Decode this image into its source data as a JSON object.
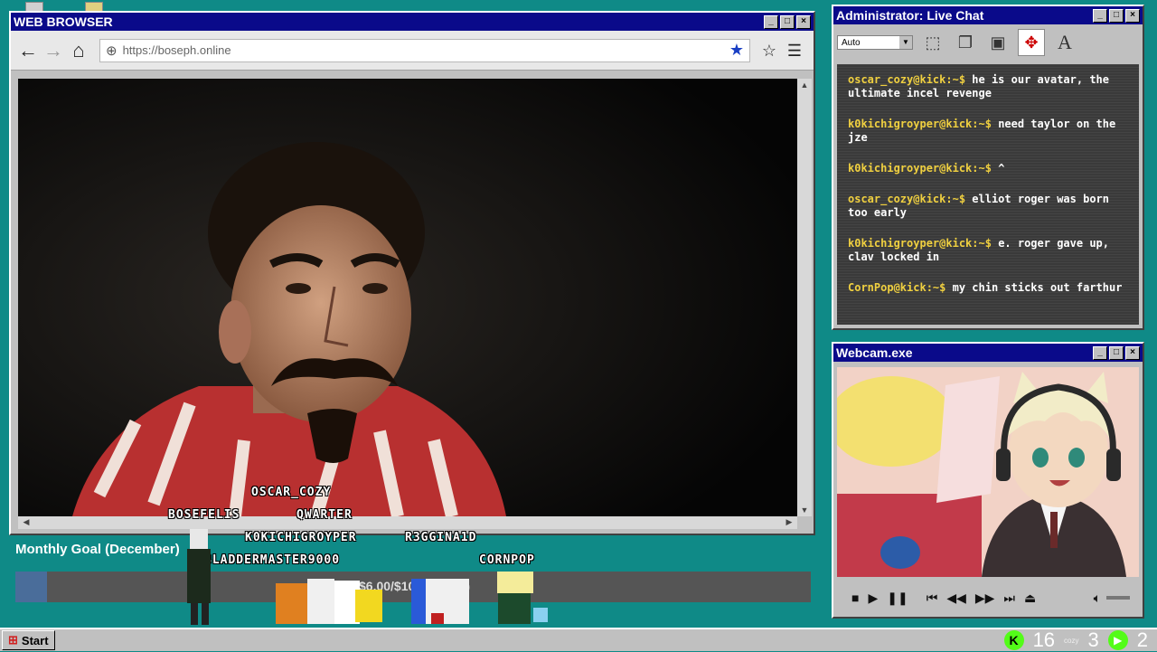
{
  "browser": {
    "title": "WEB BROWSER",
    "url": "https://boseph.online"
  },
  "chat": {
    "title": "Administrator: Live Chat",
    "size_select": "Auto",
    "messages": [
      {
        "user": "oscar_cozy@kick:~$",
        "text": "he is our avatar, the ultimate incel revenge"
      },
      {
        "user": "k0kichigroyper@kick:~$",
        "text": "need taylor on the jze"
      },
      {
        "user": "k0kichigroyper@kick:~$",
        "text": "^"
      },
      {
        "user": "oscar_cozy@kick:~$",
        "text": "elliot roger was born too early"
      },
      {
        "user": "k0kichigroyper@kick:~$",
        "text": "e. roger gave up, clav locked in"
      },
      {
        "user": "CornPop@kick:~$",
        "text": "my chin sticks out farthur"
      }
    ]
  },
  "webcam": {
    "title": "Webcam.exe"
  },
  "goal": {
    "label": "Monthly Goal (December)",
    "text": "$6.00/$100.00 (4%)",
    "progress_percent": 4
  },
  "pixel_names": [
    "OSCAR_COZY",
    "BOSEFELIS",
    "QWARTER",
    "K0KICHIGROYPER",
    "R3GGINA1D",
    "BLADDERMASTER9000",
    "CORNPOP"
  ],
  "taskbar": {
    "start_label": "Start",
    "count_a": "16",
    "count_a_label": "cozy",
    "count_b": "3",
    "count_c": "2"
  }
}
